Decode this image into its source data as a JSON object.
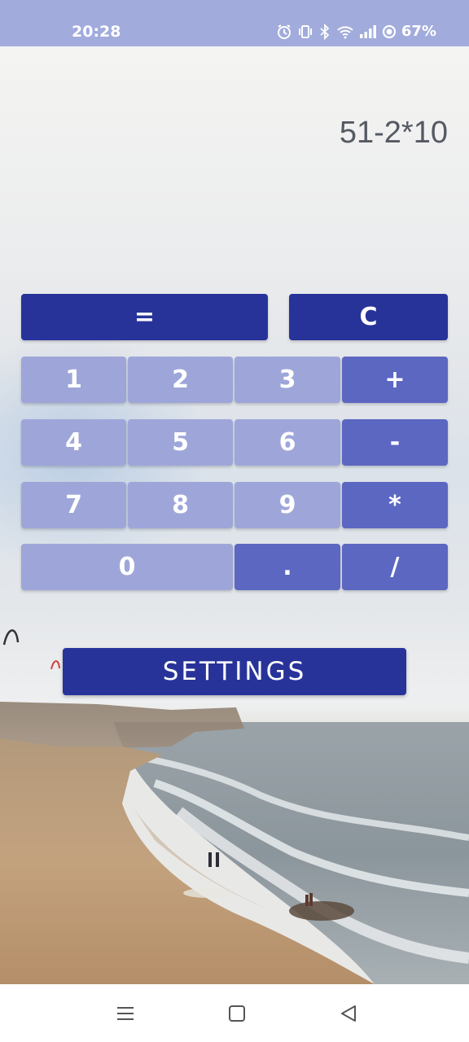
{
  "status_bar": {
    "time": "20:28",
    "battery": "67%",
    "icons": [
      "alarm-icon",
      "vibrate-icon",
      "bluetooth-icon",
      "wifi-icon",
      "signal-icon",
      "battery-icon"
    ]
  },
  "calculator": {
    "expression": "51-2*10",
    "keys": {
      "equals": "=",
      "clear": "C",
      "one": "1",
      "two": "2",
      "three": "3",
      "plus": "+",
      "four": "4",
      "five": "5",
      "six": "6",
      "minus": "-",
      "seven": "7",
      "eight": "8",
      "nine": "9",
      "multiply": "*",
      "zero": "0",
      "dot": ".",
      "divide": "/"
    },
    "settings_label": "SETTINGS"
  },
  "colors": {
    "status_bar": "#a1abdc",
    "primary_dark": "#28339a",
    "key_light": "#9ea6d9",
    "key_operator": "#5c67c2"
  },
  "navigation": {
    "icons": [
      "menu-icon",
      "home-icon",
      "back-icon"
    ]
  }
}
